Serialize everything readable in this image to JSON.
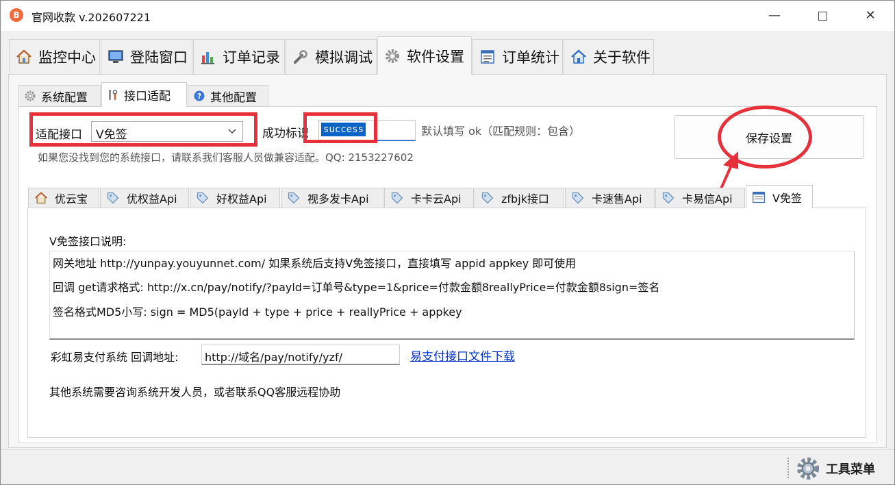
{
  "window": {
    "title": "官网收款 v.202607221",
    "minimize_glyph": "—",
    "close_glyph": "✕"
  },
  "main_tabs": [
    {
      "label": "监控中心",
      "icon": "house-icon"
    },
    {
      "label": "登陆窗口",
      "icon": "monitor-icon"
    },
    {
      "label": "订单记录",
      "icon": "bar-chart-icon"
    },
    {
      "label": "模拟调试",
      "icon": "wrench-icon"
    },
    {
      "label": "软件设置",
      "icon": "gear-icon",
      "active": true
    },
    {
      "label": "订单统计",
      "icon": "report-icon"
    },
    {
      "label": "关于软件",
      "icon": "house-icon"
    }
  ],
  "sub_tabs": [
    {
      "label": "系统配置",
      "icon": "gear-icon"
    },
    {
      "label": "接口适配",
      "icon": "tools-icon",
      "active": true
    },
    {
      "label": "其他配置",
      "icon": "help-icon"
    }
  ],
  "adapter": {
    "interface_label": "适配接口",
    "interface_value": "V免签",
    "success_label": "成功标识",
    "success_value": "success",
    "default_hint": "默认填写 ok（匹配规则：包含）",
    "contact_hint": "如果您没找到您的系统接口，请联系我们客服人员做兼容适配。QQ: 2153227602",
    "save_label": "保存设置"
  },
  "api_tabs": [
    {
      "label": "优云宝",
      "icon": "house-icon"
    },
    {
      "label": "优权益Api",
      "icon": "tag-icon"
    },
    {
      "label": "好权益Api",
      "icon": "tag-icon"
    },
    {
      "label": "视多发卡Api",
      "icon": "tag-icon"
    },
    {
      "label": "卡卡云Api",
      "icon": "tag-icon"
    },
    {
      "label": "zfbjk接口",
      "icon": "tag-icon"
    },
    {
      "label": "卡速售Api",
      "icon": "tag-icon"
    },
    {
      "label": "卡易信Api",
      "icon": "tag-icon"
    },
    {
      "label": "V免签",
      "icon": "window-icon",
      "active": true
    }
  ],
  "vmianqian": {
    "heading": "V免签接口说明:",
    "lines": [
      "网关地址 http://yunpay.youyunnet.com/  如果系统后支持V免签接口，直接填写 appid appkey 即可使用",
      "回调 get请求格式: http://x.cn/pay/notify/?payld=订单号&type=1&price=付款金额8reallyPrice=付款金额8sign=签名",
      "签名格式MD5小写: sign = MD5(payId + type + price + reallyPrice + appkey"
    ],
    "rainbow_label": "彩虹易支付系统 回调地址:",
    "rainbow_url": "http://域名/pay/notify/yzf/",
    "download_link": "易支付接口文件下载",
    "other_note": "其他系统需要咨询系统开发人员，或者联系QQ客服远程协助"
  },
  "status_bar": {
    "tools_label": "工具菜单"
  },
  "colors": {
    "highlight_red": "#e8303a",
    "selection_blue": "#0a64c8",
    "link_blue": "#0033cc"
  }
}
